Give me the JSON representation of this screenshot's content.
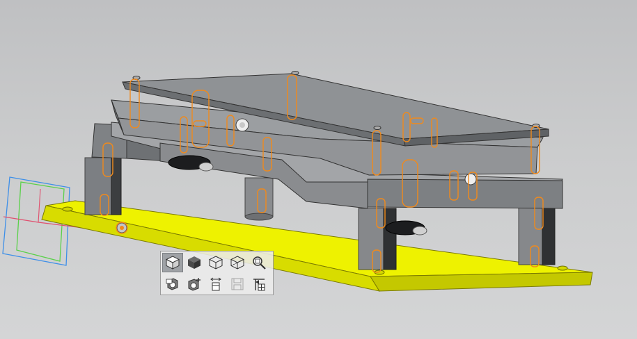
{
  "viewport": {
    "background_top": "#bfc0c2",
    "background_bottom": "#d4d5d6"
  },
  "model": {
    "base_plate_color": "#eef200",
    "body_color": "#8d8f92",
    "highlight_color": "#f08a1c",
    "axis_x_color": "#e0506e",
    "axis_y_color": "#5ad14a",
    "axis_z_color": "#3d8fe8"
  },
  "view_toolbar": {
    "row1": [
      {
        "icon": "shaded-with-edges-icon",
        "active": true
      },
      {
        "icon": "shaded-icon",
        "active": false
      },
      {
        "icon": "hidden-lines-icon",
        "active": false
      },
      {
        "icon": "wireframe-icon",
        "active": false
      },
      {
        "icon": "zoom-to-fit-icon",
        "active": false
      }
    ],
    "row2": [
      {
        "icon": "section-view-icon",
        "active": false
      },
      {
        "icon": "add-section-icon",
        "active": false
      },
      {
        "icon": "explode-view-icon",
        "active": false
      },
      {
        "icon": "save-view-icon",
        "active": false,
        "disabled": true
      },
      {
        "icon": "orientation-icon",
        "active": false
      }
    ]
  }
}
